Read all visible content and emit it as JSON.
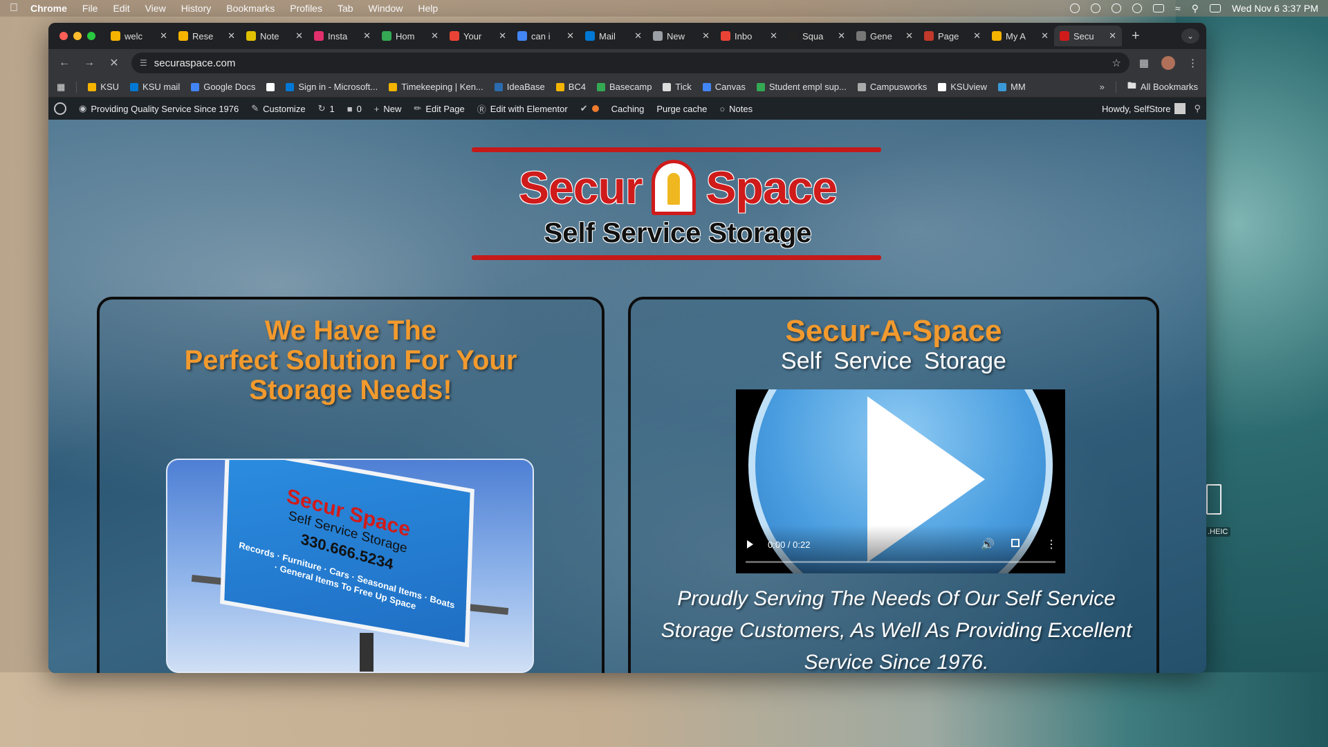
{
  "menubar": {
    "app": "Chrome",
    "items": [
      "File",
      "Edit",
      "View",
      "History",
      "Bookmarks",
      "Profiles",
      "Tab",
      "Window",
      "Help"
    ],
    "datetime": "Wed Nov 6  3:37 PM"
  },
  "tabs": [
    {
      "label": "welc",
      "color": "#f4b400"
    },
    {
      "label": "Rese",
      "color": "#f4b400"
    },
    {
      "label": "Note",
      "color": "#e0c000"
    },
    {
      "label": "Insta",
      "color": "#e1306c"
    },
    {
      "label": "Hom",
      "color": "#34a853"
    },
    {
      "label": "Your",
      "color": "#ea4335"
    },
    {
      "label": "can i",
      "color": "#4285f4"
    },
    {
      "label": "Mail",
      "color": "#0078d4"
    },
    {
      "label": "New",
      "color": "#9aa0a6"
    },
    {
      "label": "Inbo",
      "color": "#ea4335"
    },
    {
      "label": "Squa",
      "color": "#222222"
    },
    {
      "label": "Gene",
      "color": "#777777"
    },
    {
      "label": "Page",
      "color": "#c0392b"
    },
    {
      "label": "My A",
      "color": "#f4b400"
    },
    {
      "label": "Secu",
      "color": "#d01b1b",
      "active": true
    }
  ],
  "address": {
    "url": "securaspace.com"
  },
  "bookmarks": [
    {
      "label": "KSU",
      "color": "#f4b400"
    },
    {
      "label": "KSU mail",
      "color": "#0078d4"
    },
    {
      "label": "Google Docs",
      "color": "#4285f4"
    },
    {
      "label": "",
      "color": "#ffffff"
    },
    {
      "label": "Sign in - Microsoft...",
      "color": "#0078d4"
    },
    {
      "label": "Timekeeping | Ken...",
      "color": "#f4b400"
    },
    {
      "label": "IdeaBase",
      "color": "#2b6cb0"
    },
    {
      "label": "BC4",
      "color": "#f4b400"
    },
    {
      "label": "Basecamp",
      "color": "#34a853"
    },
    {
      "label": "Tick",
      "color": "#dddddd"
    },
    {
      "label": "Canvas",
      "color": "#4285f4"
    },
    {
      "label": "Student empl sup...",
      "color": "#34a853"
    },
    {
      "label": "Campusworks",
      "color": "#aaaaaa"
    },
    {
      "label": "KSUview",
      "color": "#ffffff"
    },
    {
      "label": "MM",
      "color": "#3a9ad9"
    }
  ],
  "bookmarks_all": "All Bookmarks",
  "wpbar": {
    "site": "Providing Quality Service Since 1976",
    "customize": "Customize",
    "updates": "1",
    "comments": "0",
    "new": "New",
    "edit_page": "Edit Page",
    "elementor": "Edit with Elementor",
    "caching": "Caching",
    "purge": "Purge cache",
    "notes": "Notes",
    "howdy": "Howdy, SelfStore"
  },
  "logo": {
    "left": "Secur",
    "right": "Space",
    "sub": "Self Service Storage"
  },
  "card_left": {
    "heading_lines": [
      "We Have The",
      "Perfect Solution For Your",
      "Storage Needs!"
    ],
    "billboard": {
      "title": "Secur Space",
      "sub": "Self Service Storage",
      "phone": "330.666.5234",
      "items": "Records · Furniture · Cars · Seasonal Items · Boats · General Items To Free Up Space"
    }
  },
  "card_right": {
    "heading": "Secur-A-Space",
    "subheading": "Self  Service  Storage",
    "video_time": "0:00 / 0:22",
    "body": "Proudly Serving The Needs Of Our Self Service Storage Customers, As Well As Providing Excellent Service Since 1976."
  },
  "desktop": {
    "file_label": ".HEIC"
  }
}
